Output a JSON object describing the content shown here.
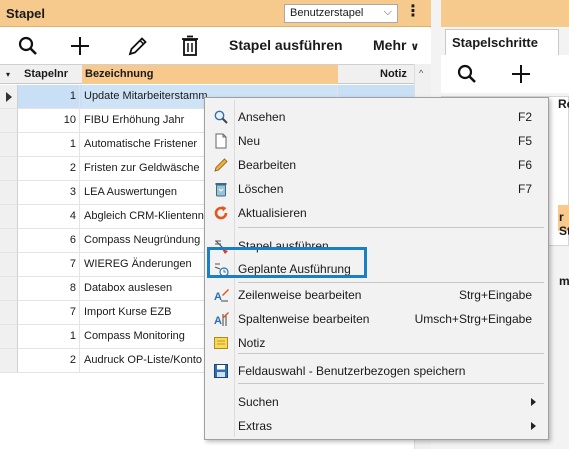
{
  "left_panel": {
    "title": "Stapel",
    "select_value": "Benutzerstapel",
    "toolbar": {
      "execute_label": "Stapel ausführen",
      "more_label": "Mehr"
    },
    "columns": {
      "stapelnr": "Stapelnr",
      "bezeichnung": "Bezeichnung",
      "notiz": "Notiz"
    },
    "rows": [
      {
        "nr": "1",
        "bez": "Update Mitarbeiterstamm"
      },
      {
        "nr": "10",
        "bez": "FIBU Erhöhung Jahr"
      },
      {
        "nr": "1",
        "bez": "Automatische Fristener"
      },
      {
        "nr": "2",
        "bez": "Fristen zur Geldwäsche"
      },
      {
        "nr": "3",
        "bez": "LEA Auswertungen"
      },
      {
        "nr": "4",
        "bez": "Abgleich CRM-Klientenn"
      },
      {
        "nr": "6",
        "bez": "Compass Neugründung"
      },
      {
        "nr": "7",
        "bez": "WIEREG Änderungen"
      },
      {
        "nr": "8",
        "bez": "Databox auslesen"
      },
      {
        "nr": "7",
        "bez": "Import Kurse EZB"
      },
      {
        "nr": "1",
        "bez": "Compass Monitoring"
      },
      {
        "nr": "2",
        "bez": "Audruck OP-Liste/Konto"
      }
    ]
  },
  "right_panel": {
    "tab_label": "Stapelschritte",
    "frag_r": "Re",
    "frag_sta": "r Sta",
    "frag_me": "me"
  },
  "context_menu": {
    "items": [
      {
        "label": "Ansehen",
        "shortcut": "F2",
        "icon": "magnifier-icon"
      },
      {
        "label": "Neu",
        "shortcut": "F5",
        "icon": "new-document-icon"
      },
      {
        "label": "Bearbeiten",
        "shortcut": "F6",
        "icon": "pencil-icon"
      },
      {
        "label": "Löschen",
        "shortcut": "F7",
        "icon": "trash-icon"
      },
      {
        "label": "Aktualisieren",
        "shortcut": "",
        "icon": "refresh-icon"
      },
      {
        "label": "Stapel ausführen",
        "shortcut": "",
        "icon": "run-batch-icon"
      },
      {
        "label": "Geplante Ausführung",
        "shortcut": "",
        "icon": "scheduled-run-icon"
      },
      {
        "label": "Zeilenweise bearbeiten",
        "shortcut": "Strg+Eingabe",
        "icon": "row-edit-icon"
      },
      {
        "label": "Spaltenweise bearbeiten",
        "shortcut": "Umsch+Strg+Eingabe",
        "icon": "column-edit-icon"
      },
      {
        "label": "Notiz",
        "shortcut": "",
        "icon": "note-icon"
      },
      {
        "label": "Feldauswahl - Benutzerbezogen speichern",
        "shortcut": "",
        "icon": "save-icon"
      },
      {
        "label": "Suchen",
        "shortcut": "",
        "icon": ""
      },
      {
        "label": "Extras",
        "shortcut": "",
        "icon": ""
      }
    ]
  },
  "colors": {
    "header_orange": "#f5ca8c",
    "selection_blue": "#c8dff5",
    "highlight_frame": "#1a7fc4"
  }
}
